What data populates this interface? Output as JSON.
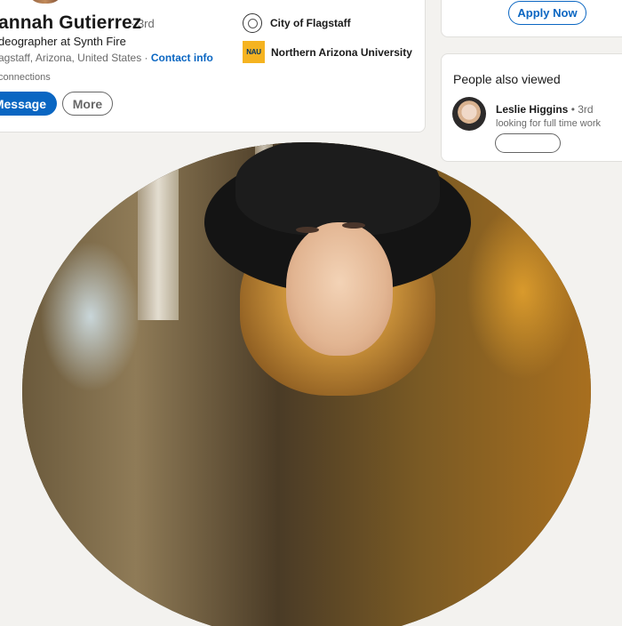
{
  "profile": {
    "name": "annah Gutierrez",
    "degree": "· 3rd",
    "headline": "deographer at Synth Fire",
    "location": "agstaff, Arizona, United States ·",
    "contact_info": "Contact info",
    "connections": "connections",
    "message_label": "Message",
    "more_label": "More"
  },
  "organizations": [
    {
      "name": "City of Flagstaff",
      "icon": "city-seal-icon"
    },
    {
      "name": "Northern Arizona University",
      "logo_text": "NAU",
      "icon": "nau-logo",
      "color": "#f5b320"
    }
  ],
  "job_card": {
    "apply_label": "Apply Now"
  },
  "people_also_viewed": {
    "title": "People also viewed",
    "people": [
      {
        "name": "Leslie Higgins",
        "degree": "3rd",
        "headline": "looking for full time work"
      }
    ]
  },
  "colors": {
    "accent": "#0a66c2",
    "background": "#f3f2ef"
  }
}
